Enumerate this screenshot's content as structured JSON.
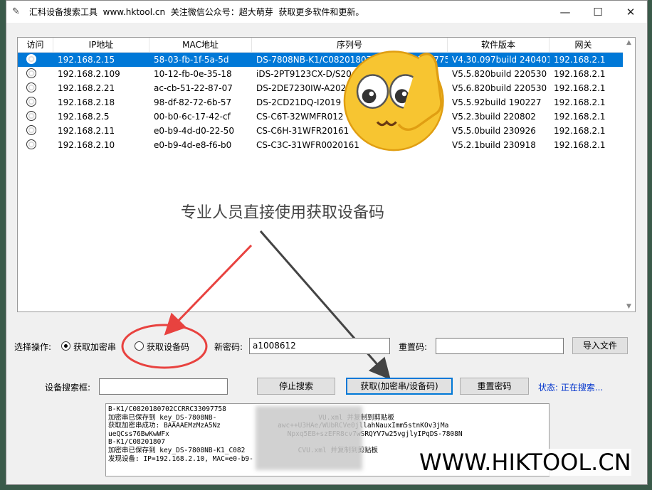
{
  "window": {
    "title": "汇科设备搜索工具  www.hktool.cn  关注微信公众号：超大萌芽  获取更多软件和更新。",
    "minimize": "—",
    "maximize": "☐",
    "close": "✕"
  },
  "table": {
    "headers": [
      "访问",
      "IP地址",
      "MAC地址",
      "序列号",
      "软件版本",
      "网关"
    ],
    "rows": [
      {
        "ip": "192.168.2.15",
        "mac": "58-03-fb-1f-5a-5d",
        "serial": "DS-7808NB-K1/C0820180702CCRRC33097758",
        "version": "V4.30.097build 240401",
        "gateway": "192.168.2.1",
        "selected": true
      },
      {
        "ip": "192.168.2.109",
        "mac": "10-12-fb-0e-35-18",
        "serial": "iDS-2PT9123CX-D/S20",
        "version": "V5.5.820build 220530",
        "gateway": "192.168.2.1",
        "selected": false
      },
      {
        "ip": "192.168.2.21",
        "mac": "ac-cb-51-22-87-07",
        "serial": "DS-2DE7230IW-A202",
        "version": "V5.6.820build 220530",
        "gateway": "192.168.2.1",
        "selected": false
      },
      {
        "ip": "192.168.2.18",
        "mac": "98-df-82-72-6b-57",
        "serial": "DS-2CD21DQ-I2019",
        "version": "V5.5.92build 190227",
        "gateway": "192.168.2.1",
        "selected": false
      },
      {
        "ip": "192.168.2.5",
        "mac": "00-b0-6c-17-42-cf",
        "serial": "CS-C6T-32WMFR012",
        "version": "V5.2.3build 220802",
        "gateway": "192.168.2.1",
        "selected": false
      },
      {
        "ip": "192.168.2.11",
        "mac": "e0-b9-4d-d0-22-50",
        "serial": "CS-C6H-31WFR20161",
        "version": "V5.5.0build 230926",
        "gateway": "192.168.2.1",
        "selected": false
      },
      {
        "ip": "192.168.2.10",
        "mac": "e0-b9-4d-e8-f6-b0",
        "serial": "CS-C3C-31WFR0020161",
        "version": "V5.2.1build 230918",
        "gateway": "192.168.2.1",
        "selected": false
      }
    ]
  },
  "annotation": "专业人员直接使用获取设备码",
  "controls": {
    "operation_label": "选择操作:",
    "radio_encrypt": "获取加密串",
    "radio_device": "获取设备码",
    "new_password_label": "新密码:",
    "new_password_value": "a1008612",
    "reset_code_label": "重置码:",
    "reset_code_value": "",
    "import_button": "导入文件",
    "search_box_label": "设备搜索框:",
    "search_box_value": "",
    "stop_button": "停止搜索",
    "get_button": "获取(加密串/设备码)",
    "reset_button": "重置密码",
    "status": "状态: 正在搜索..."
  },
  "log": {
    "lines": [
      "B-K1/C0820180702CCRRC33097758",
      "加密串已保存到 key_DS-7808NB-                         VU.xml 并复制到剪贴板",
      "获取加密串成功: BAAAAEMzMzA5Nz              awc++U3HAe/WUbRCVe0jllahNauxImm5stnKOv3jMa",
      "ueQCss76BwKwWFx                             Npxq5EB+szEFR8cv7wSRQYV7w25vgjlyIPqDS-7808N",
      "B-K1/C08201807",
      "加密串已保存到 key_DS-7808NB-K1_C082             CVU.xml 并复制到剪贴板",
      "发现设备: IP=192.168.2.10, MAC=e0-b9-"
    ]
  },
  "watermark": "WWW.HIKTOOL.CN",
  "colors": {
    "selection": "#0078d7",
    "annotation_arrow": "#e8423f",
    "status": "#0033cc"
  }
}
